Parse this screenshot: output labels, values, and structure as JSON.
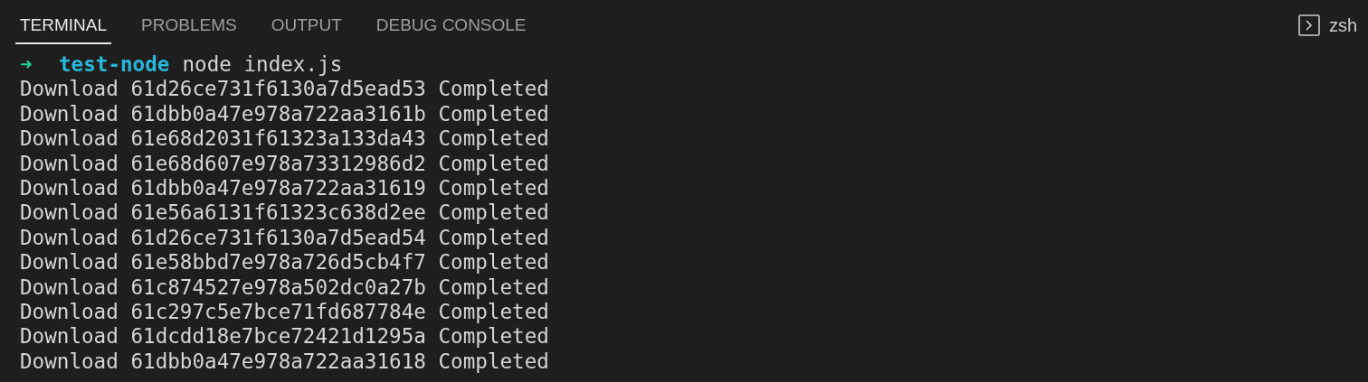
{
  "tabs": [
    {
      "label": "TERMINAL",
      "selected": true
    },
    {
      "label": "PROBLEMS",
      "selected": false
    },
    {
      "label": "OUTPUT",
      "selected": false
    },
    {
      "label": "DEBUG CONSOLE",
      "selected": false
    }
  ],
  "shell": {
    "name": "zsh"
  },
  "prompt": {
    "arrow": "➜",
    "cwd": "test-node",
    "command": "node index.js"
  },
  "output_lines": [
    "Download 61d26ce731f6130a7d5ead53 Completed",
    "Download 61dbb0a47e978a722aa3161b Completed",
    "Download 61e68d2031f61323a133da43 Completed",
    "Download 61e68d607e978a73312986d2 Completed",
    "Download 61dbb0a47e978a722aa31619 Completed",
    "Download 61e56a6131f61323c638d2ee Completed",
    "Download 61d26ce731f6130a7d5ead54 Completed",
    "Download 61e58bbd7e978a726d5cb4f7 Completed",
    "Download 61c874527e978a502dc0a27b Completed",
    "Download 61c297c5e7bce71fd687784e Completed",
    "Download 61dcdd18e7bce72421d1295a Completed",
    "Download 61dbb0a47e978a722aa31618 Completed"
  ]
}
